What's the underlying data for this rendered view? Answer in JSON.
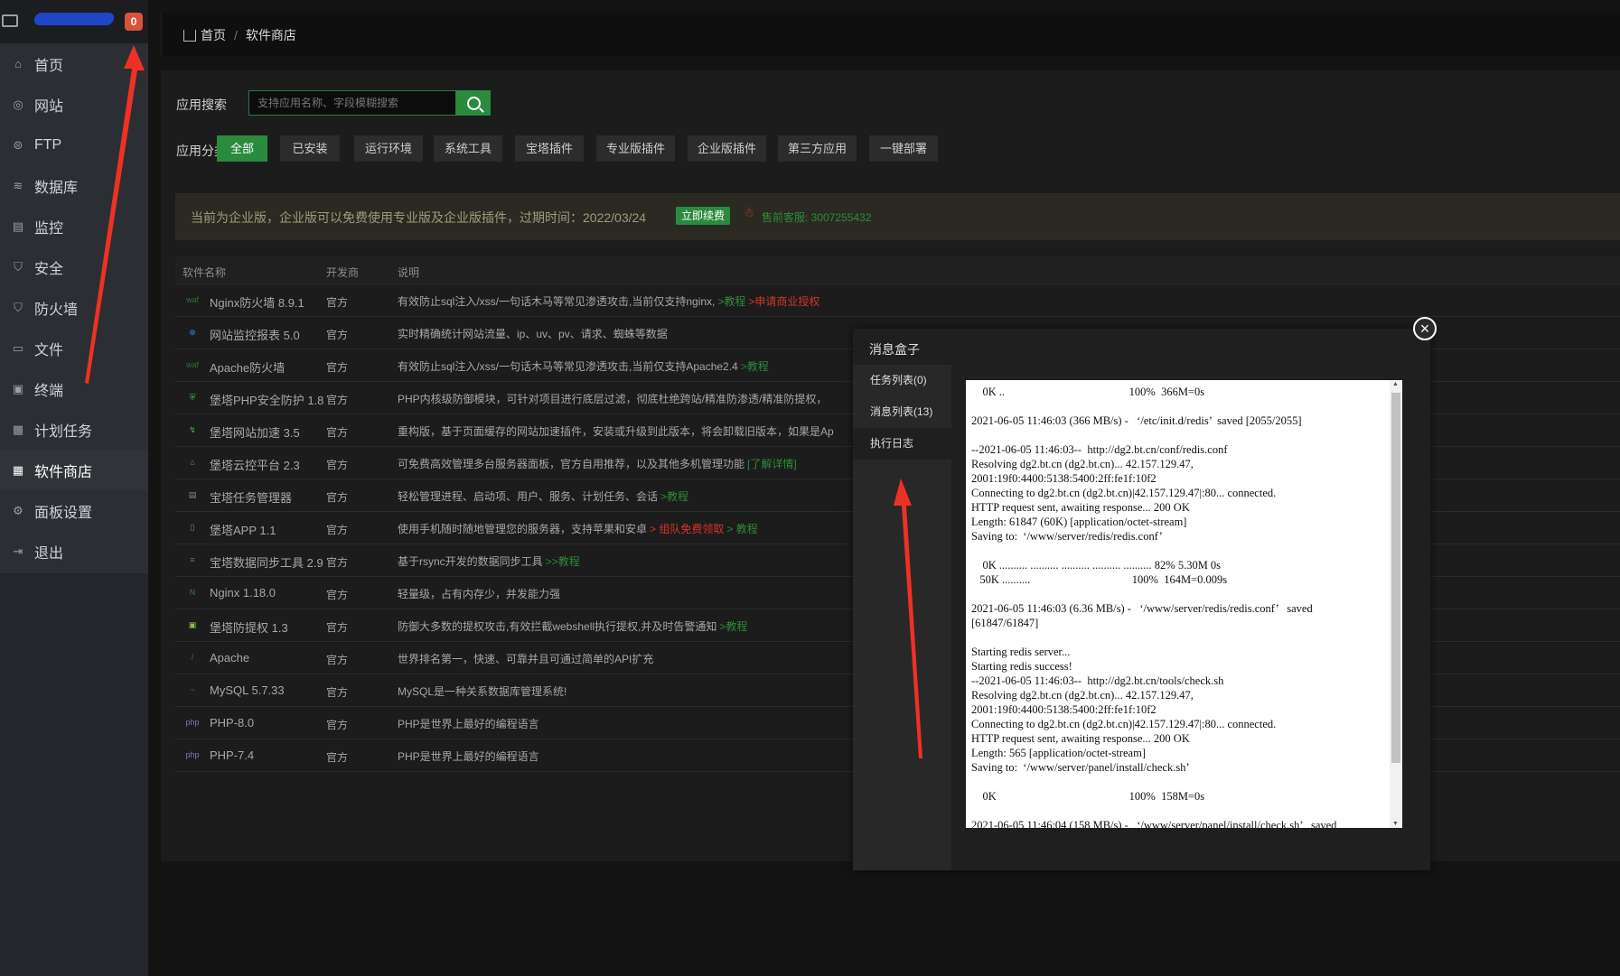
{
  "sidebar": {
    "badge": "0",
    "items": [
      {
        "label": "首页",
        "icon": "home-icon"
      },
      {
        "label": "网站",
        "icon": "globe-icon"
      },
      {
        "label": "FTP",
        "icon": "ftp-icon"
      },
      {
        "label": "数据库",
        "icon": "database-icon"
      },
      {
        "label": "监控",
        "icon": "monitor-icon"
      },
      {
        "label": "安全",
        "icon": "shield-icon"
      },
      {
        "label": "防火墙",
        "icon": "firewall-icon"
      },
      {
        "label": "文件",
        "icon": "folder-icon"
      },
      {
        "label": "终端",
        "icon": "terminal-icon"
      },
      {
        "label": "计划任务",
        "icon": "calendar-icon"
      },
      {
        "label": "软件商店",
        "icon": "grid-icon",
        "active": true
      },
      {
        "label": "面板设置",
        "icon": "gear-icon"
      },
      {
        "label": "退出",
        "icon": "logout-icon"
      }
    ]
  },
  "header": {
    "home": "首页",
    "separator": "/",
    "current": "软件商店"
  },
  "search": {
    "label": "应用搜索",
    "placeholder": "支持应用名称、字段模糊搜索"
  },
  "categories": {
    "label": "应用分类",
    "items": [
      "全部",
      "已安装",
      "运行环境",
      "系统工具",
      "宝塔插件",
      "专业版插件",
      "企业版插件",
      "第三方应用",
      "一键部署"
    ]
  },
  "notice": {
    "text": "当前为企业版，企业版可以免费使用专业版及企业版插件，过期时间：2022/03/24",
    "renew": "立即续费",
    "service": "售前客服: 3007255432"
  },
  "table": {
    "headers": [
      "软件名称",
      "开发商",
      "说明"
    ],
    "rows": [
      {
        "name": "Nginx防火墙 8.9.1",
        "dev": "官方",
        "desc": "有效防止sql注入/xss/一句话木马等常见渗透攻击,当前仅支持nginx,",
        "link1": ">教程",
        "link2": ">申请商业授权"
      },
      {
        "name": "网站监控报表 5.0",
        "dev": "官方",
        "desc": "实时精确统计网站流量、ip、uv、pv、请求、蜘蛛等数据",
        "link1": "",
        "link2": ""
      },
      {
        "name": "Apache防火墙",
        "dev": "官方",
        "desc": "有效防止sql注入/xss/一句话木马等常见渗透攻击,当前仅支持Apache2.4",
        "link1": ">教程",
        "link2": ""
      },
      {
        "name": "堡塔PHP安全防护 1.8",
        "dev": "官方",
        "desc": "PHP内核级防御模块，可针对项目进行底层过滤，彻底杜绝跨站/精准防渗透/精准防提权，",
        "link1": "",
        "link2": ""
      },
      {
        "name": "堡塔网站加速 3.5",
        "dev": "官方",
        "desc": "重构版，基于页面缓存的网站加速插件，安装或升级到此版本，将会卸载旧版本，如果是Ap",
        "link1": "",
        "link2": ""
      },
      {
        "name": "堡塔云控平台 2.3",
        "dev": "官方",
        "desc": "可免费高效管理多台服务器面板，官方自用推荐，以及其他多机管理功能",
        "link1": "[了解详情]",
        "link2": ""
      },
      {
        "name": "宝塔任务管理器",
        "dev": "官方",
        "desc": "轻松管理进程、启动项、用户、服务、计划任务、会话",
        "link1": ">教程",
        "link2": ""
      },
      {
        "name": "堡塔APP 1.1",
        "dev": "官方",
        "desc": "使用手机随时随地管理您的服务器，支持苹果和安卓",
        "link1": "",
        "link2": "> 组队免费领取",
        "link3": "> 教程"
      },
      {
        "name": "宝塔数据同步工具 2.9",
        "dev": "官方",
        "desc": "基于rsync开发的数据同步工具",
        "link1": ">>教程",
        "link2": ""
      },
      {
        "name": "Nginx 1.18.0",
        "dev": "官方",
        "desc": "轻量级，占有内存少，并发能力强",
        "link1": "",
        "link2": ""
      },
      {
        "name": "堡塔防提权 1.3",
        "dev": "官方",
        "desc": "防御大多数的提权攻击,有效拦截webshell执行提权,并及时告警通知",
        "link1": ">教程",
        "link2": ""
      },
      {
        "name": "Apache",
        "dev": "官方",
        "desc": "世界排名第一，快速、可靠并且可通过简单的API扩充",
        "link1": "",
        "link2": ""
      },
      {
        "name": "MySQL 5.7.33",
        "dev": "官方",
        "desc": "MySQL是一种关系数据库管理系统!",
        "link1": "",
        "link2": ""
      },
      {
        "name": "PHP-8.0",
        "dev": "官方",
        "desc": "PHP是世界上最好的编程语言",
        "link1": "",
        "link2": ""
      },
      {
        "name": "PHP-7.4",
        "dev": "官方",
        "desc": "PHP是世界上最好的编程语言",
        "link1": "",
        "link2": ""
      }
    ]
  },
  "modal": {
    "title": "消息盒子",
    "close": "×",
    "tabs": [
      "任务列表(0)",
      "消息列表(13)",
      "执行日志"
    ],
    "log": "    0K ..                                            100%  366M=0s\n\n2021-06-05 11:46:03 (366 MB/s) -   ‘/etc/init.d/redis’  saved [2055/2055]\n\n--2021-06-05 11:46:03--  http://dg2.bt.cn/conf/redis.conf\nResolving dg2.bt.cn (dg2.bt.cn)... 42.157.129.47,\n2001:19f0:4400:5138:5400:2ff:fe1f:10f2\nConnecting to dg2.bt.cn (dg2.bt.cn)|42.157.129.47|:80... connected.\nHTTP request sent, awaiting response... 200 OK\nLength: 61847 (60K) [application/octet-stream]\nSaving to:  ‘/www/server/redis/redis.conf’\n\n    0K .......... .......... .......... .......... .......... 82% 5.30M 0s\n   50K ..........                                    100%  164M=0.009s\n\n2021-06-05 11:46:03 (6.36 MB/s) -   ‘/www/server/redis/redis.conf’   saved\n[61847/61847]\n\nStarting redis server...\nStarting redis success!\n--2021-06-05 11:46:03--  http://dg2.bt.cn/tools/check.sh\nResolving dg2.bt.cn (dg2.bt.cn)... 42.157.129.47,\n2001:19f0:4400:5138:5400:2ff:fe1f:10f2\nConnecting to dg2.bt.cn (dg2.bt.cn)|42.157.129.47|:80... connected.\nHTTP request sent, awaiting response... 200 OK\nLength: 565 [application/octet-stream]\nSaving to:  ‘/www/server/panel/install/check.sh’\n\n    0K                                               100%  158M=0s\n\n2021-06-05 11:46:04 (158 MB/s) -   ‘/www/server/panel/install/check.sh’   saved"
  }
}
